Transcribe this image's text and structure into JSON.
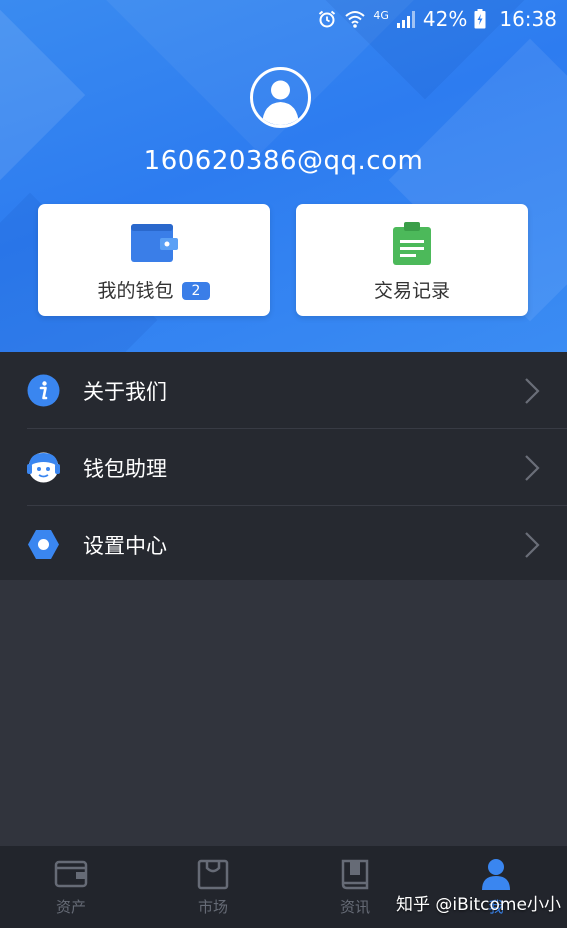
{
  "status_bar": {
    "battery": "42%",
    "network": "4G",
    "time": "16:38",
    "icons": [
      "alarm-icon",
      "wifi-icon",
      "signal-icon",
      "battery-icon"
    ]
  },
  "profile": {
    "email": "160620386@qq.com",
    "avatar_icon": "user-avatar-icon"
  },
  "cards": {
    "wallet": {
      "label": "我的钱包",
      "count": "2",
      "icon": "wallet-icon",
      "color": "#3a7ee8"
    },
    "records": {
      "label": "交易记录",
      "icon": "clipboard-icon",
      "color": "#4cb95a"
    }
  },
  "menu": [
    {
      "label": "关于我们",
      "icon": "info-icon"
    },
    {
      "label": "钱包助理",
      "icon": "assistant-icon"
    },
    {
      "label": "设置中心",
      "icon": "settings-icon"
    }
  ],
  "tabs": [
    {
      "label": "资产",
      "icon": "wallet-tab-icon"
    },
    {
      "label": "市场",
      "icon": "shopping-bag-icon"
    },
    {
      "label": "资讯",
      "icon": "book-icon"
    },
    {
      "label": "我",
      "icon": "person-icon",
      "active": true
    }
  ],
  "watermark": "知乎 @iBitcome小小",
  "colors": {
    "header_blue": "#2d7cf0",
    "accent_blue": "#3a86f0",
    "menu_bg": "#262930",
    "page_bg": "#31343d",
    "tabbar_bg": "#22252c"
  }
}
